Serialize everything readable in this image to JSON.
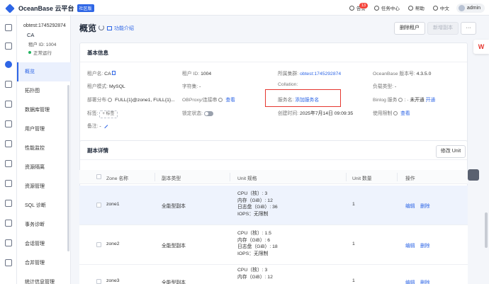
{
  "header": {
    "logo_text": "OceanBase 云平台",
    "edition_badge": "社区版",
    "alerts_label": "告警",
    "alerts_count": "13",
    "tasks_label": "任务中心",
    "help_label": "帮助",
    "lang_label": "中文",
    "user_name": "admin"
  },
  "sidebar": {
    "instance_name": "obtest:1745292874",
    "tenant_name": "CA",
    "tenant_id": "租户 ID: 1004",
    "status": "正常运行",
    "status_color": "#22b35e",
    "items": [
      {
        "label": "概览"
      },
      {
        "label": "拓扑图"
      },
      {
        "label": "数据库管理"
      },
      {
        "label": "用户管理"
      },
      {
        "label": "性能监控"
      },
      {
        "label": "资源隔离"
      },
      {
        "label": "资源管理"
      },
      {
        "label": "SQL 诊断"
      },
      {
        "label": "事务诊断"
      },
      {
        "label": "会话管理"
      },
      {
        "label": "合并管理"
      },
      {
        "label": "统计信息管理"
      }
    ]
  },
  "page": {
    "title": "概览",
    "intro_link": "功能介绍",
    "delete_tenant": "删除租户",
    "add_replica": "新增副本",
    "more_label": "···"
  },
  "basic_info": {
    "title": "基本信息",
    "tenant_name_k": "租户名:",
    "tenant_name_v": "CA",
    "tenant_id_k": "租户 ID:",
    "tenant_id_v": "1004",
    "cluster_k": "所属集群:",
    "cluster_v": "obtest:1745292874",
    "version_k": "OceanBase 版本号:",
    "version_v": "4.3.5.0",
    "mode_k": "租户模式:",
    "mode_v": "MySQL",
    "charset_k": "字符集:",
    "charset_v": "-",
    "collation_k": "Collation:",
    "collation_v": "",
    "load_type_k": "负载类型:",
    "load_type_v": "-",
    "deploy_k": "部署分布",
    "deploy_v": "FULL{1}@zone1, FULL{1}...",
    "obproxy_k": "OBProxy/连接串",
    "obproxy_v": "查看",
    "service_k": "服务名:",
    "service_v": "添加服务名",
    "binlog_k": "Binlog 服务",
    "binlog_v": "未开通",
    "binlog_action": "开通",
    "tags_k": "标签:",
    "tags_btn": "+ 标签",
    "lock_k": "锁定状态:",
    "created_k": "创建时间:",
    "created_v": "2025年7月14日 09:09:35",
    "limit_k": "使用限制",
    "limit_v": "查看",
    "remark_k": "备注:",
    "remark_v": "-"
  },
  "replica": {
    "title": "副本详情",
    "modify_unit": "修改 Unit",
    "headers": {
      "zone": "Zone 名称",
      "type": "副本类型",
      "unit": "Unit 规格",
      "count": "Unit 数量",
      "op": "操作"
    },
    "rows": [
      {
        "zone": "zone1",
        "type": "全能型副本",
        "cpu": "CPU（核）: 3",
        "mem": "内存（GiB）: 12",
        "log": "日志盘（GiB）: 36",
        "iops": "IOPS：无限制",
        "count": "1",
        "edit": "编辑",
        "del": "删除"
      },
      {
        "zone": "zone2",
        "type": "全能型副本",
        "cpu": "CPU（核）: 1.5",
        "mem": "内存（GiB）: 6",
        "log": "日志盘（GiB）: 18",
        "iops": "IOPS：无限制",
        "count": "1",
        "edit": "编辑",
        "del": "删除"
      },
      {
        "zone": "zone3",
        "type": "全能型副本",
        "cpu": "CPU（核）: 3",
        "mem": "内存（GiB）: 12",
        "log": "",
        "iops": "",
        "count": "1",
        "edit": "编辑",
        "del": "删除"
      }
    ]
  },
  "colors": {
    "accent": "#2e66e6",
    "highlight_box": "#e5372f"
  }
}
